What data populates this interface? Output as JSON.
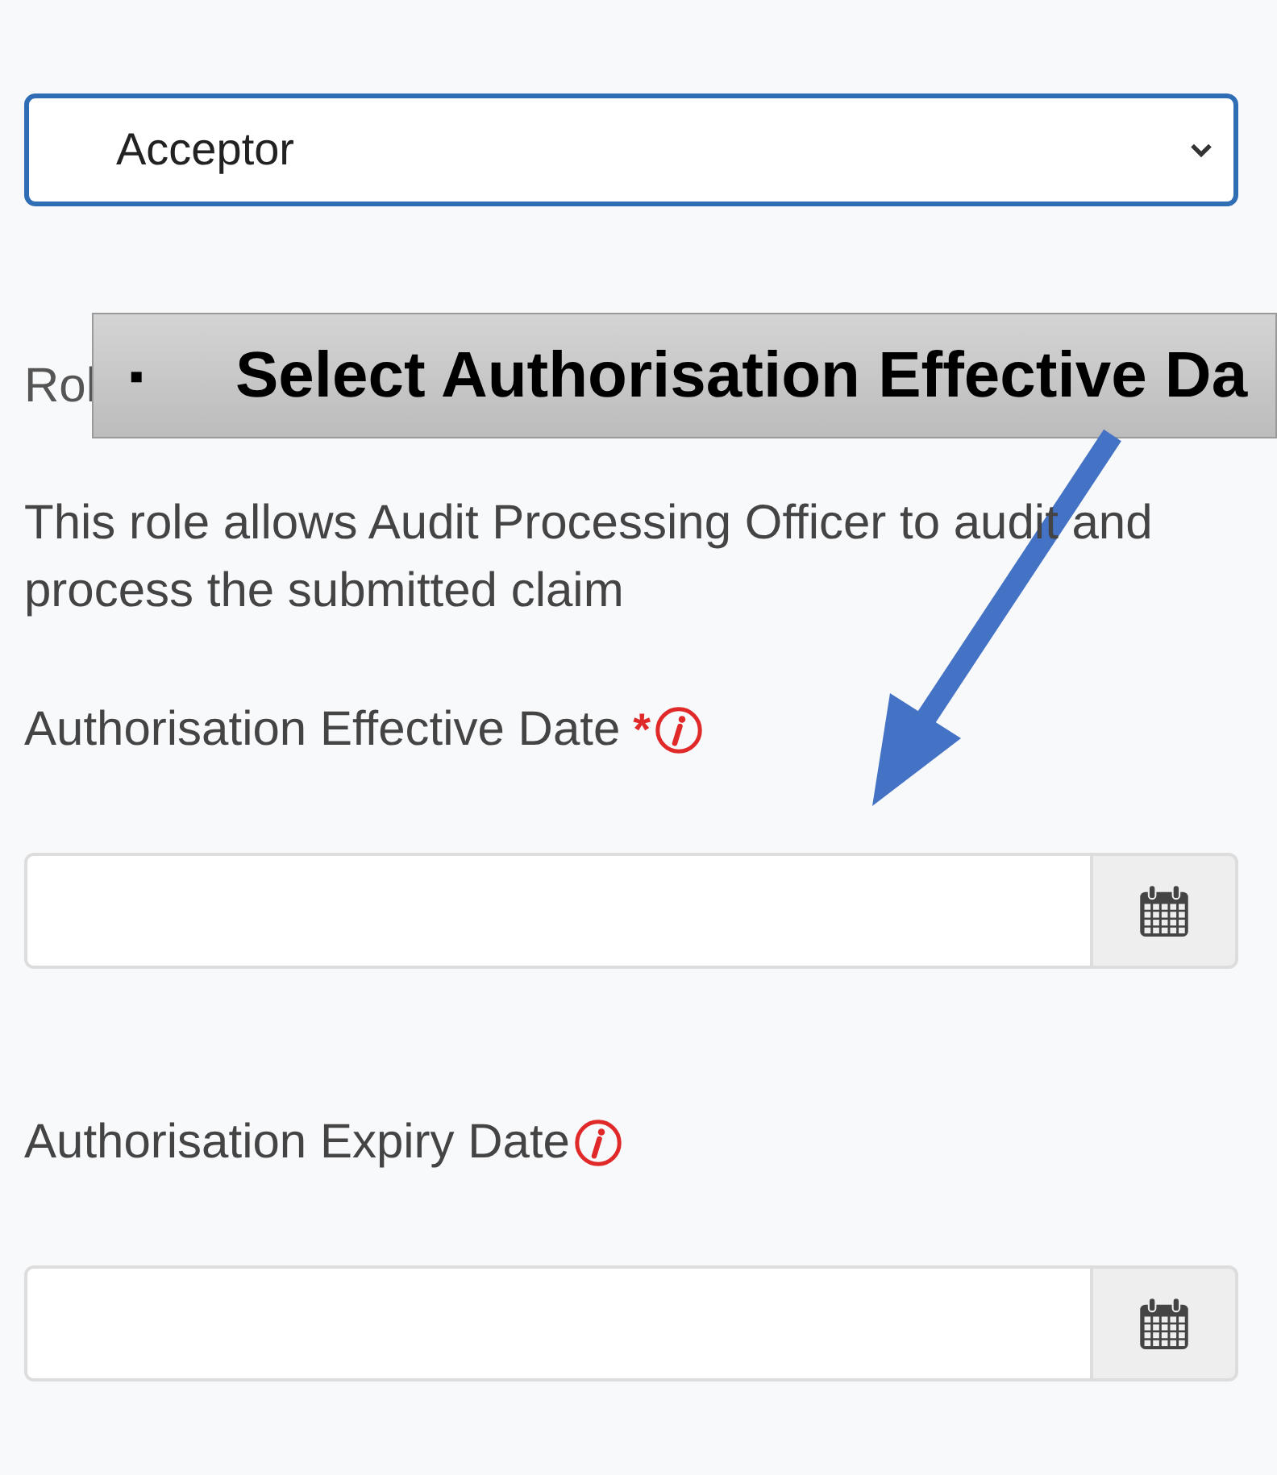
{
  "role_select": {
    "value": "Acceptor"
  },
  "role_label": "Rol",
  "callout": {
    "bullet": "▪",
    "text": "Select Authorisation Effective Da"
  },
  "role_description": "This role allows Audit Processing Officer to audit and process the submitted claim",
  "date_fields": [
    {
      "label": "Authorisation Effective Date",
      "required_mark": "*"
    },
    {
      "label": "Authorisation Expiry Date"
    }
  ]
}
